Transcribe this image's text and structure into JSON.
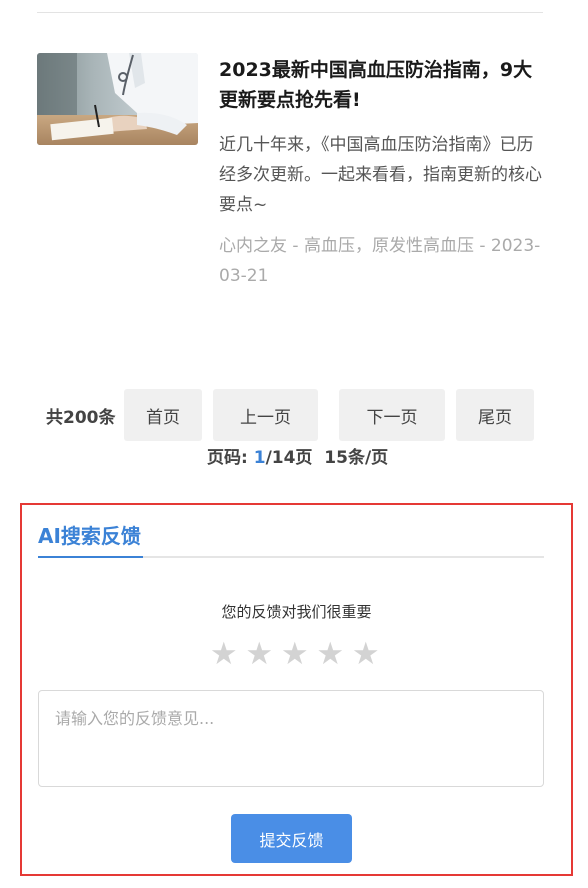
{
  "article": {
    "title": "2023最新中国高血压防治指南，9大更新要点抢先看!",
    "summary": "近几十年来，《中国高血压防治指南》已历经多次更新。一起来看看，指南更新的核心要点~",
    "meta": "心内之友 - 高血压，原发性高血压 - 2023-03-21"
  },
  "pagination": {
    "total": "共200条",
    "first": "首页",
    "prev": "上一页",
    "next": "下一页",
    "last": "尾页",
    "page_label": "页码: ",
    "current_page": "1",
    "total_pages": "/14页",
    "per_page": "15条/页"
  },
  "feedback": {
    "tab": "AI搜索反馈",
    "prompt": "您的反馈对我们很重要",
    "rating": {
      "value": 0,
      "max": 5
    },
    "placeholder": "请输入您的反馈意见...",
    "submit": "提交反馈"
  }
}
